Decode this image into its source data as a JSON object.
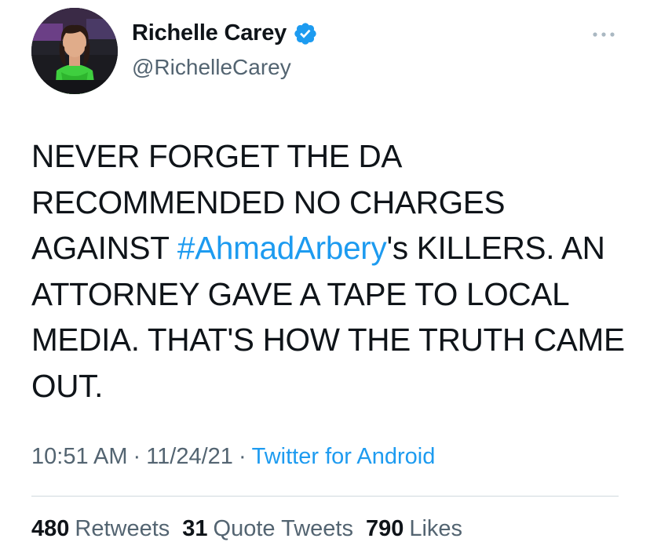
{
  "author": {
    "display_name": "Richelle Carey",
    "handle": "@RichelleCarey",
    "verified": true,
    "avatar": "profile-photo"
  },
  "tweet": {
    "text_before": "NEVER FORGET THE DA RECOMMENDED NO CHARGES AGAINST ",
    "hashtag": "#AhmadArbery",
    "text_after": "'s KILLERS. AN ATTORNEY GAVE A TAPE TO LOCAL MEDIA. THAT'S HOW THE TRUTH CAME OUT."
  },
  "meta": {
    "time": "10:51 AM",
    "separator": "·",
    "date": "11/24/21",
    "source": "Twitter for Android"
  },
  "stats": {
    "retweets_count": "480",
    "retweets_label": "Retweets",
    "quote_count": "31",
    "quote_label": "Quote Tweets",
    "likes_count": "790",
    "likes_label": "Likes"
  },
  "icons": {
    "more": "more-horizontal-icon",
    "verified": "verified-badge-icon"
  },
  "colors": {
    "accent": "#1d9bf0",
    "text": "#0f1419",
    "secondary": "#536471",
    "divider": "#cfd9de"
  }
}
